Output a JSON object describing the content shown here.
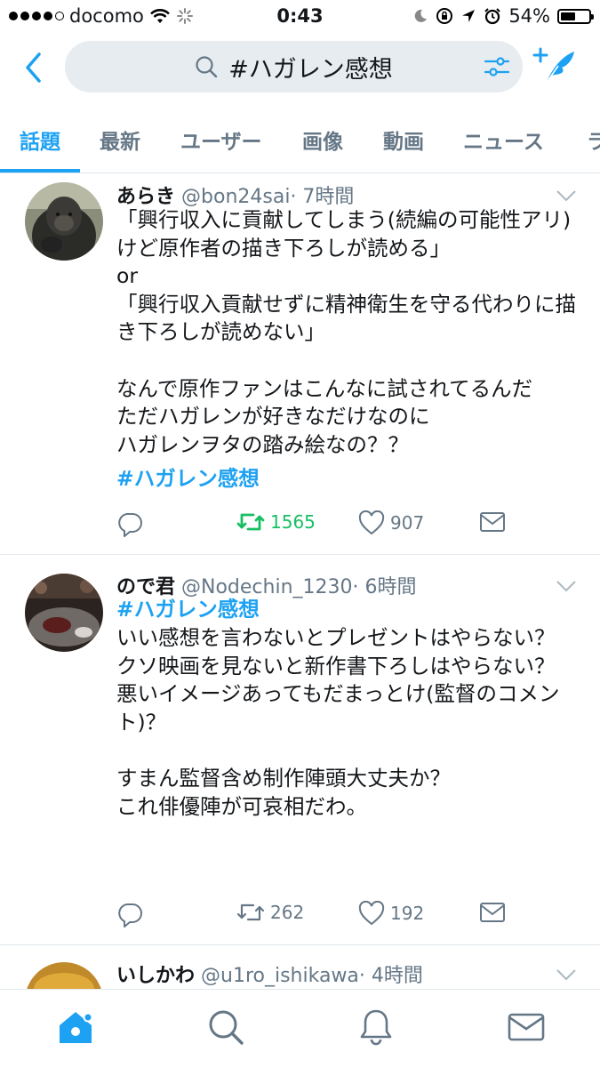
{
  "status_bar": {
    "carrier": "docomo",
    "time": "0:43",
    "battery": "54%",
    "battery_level": 0.54
  },
  "search": {
    "query": "#ハガレン感想"
  },
  "tabs": [
    {
      "label": "話題",
      "active": true
    },
    {
      "label": "最新",
      "active": false
    },
    {
      "label": "ユーザー",
      "active": false
    },
    {
      "label": "画像",
      "active": false
    },
    {
      "label": "動画",
      "active": false
    },
    {
      "label": "ニュース",
      "active": false
    },
    {
      "label": "ラ",
      "active": false
    }
  ],
  "tweets": [
    {
      "name": "あらき",
      "handle": "@bon24sai",
      "time": "· 7時間",
      "body": "「興行収入に貢献してしまう(続編の可能性アリ) けど原作者の描き下ろしが読める」\nor\n「興行収入貢献せずに精神衛生を守る代わりに描き下ろしが読めない」\n\nなんで原作ファンはこんなに試されてるんだ\nただハガレンが好きなだけなのに\nハガレンヲタの踏み絵なの？？",
      "hashtag": "#ハガレン感想",
      "retweets": "1565",
      "likes": "907"
    },
    {
      "name": "ので君",
      "handle": "@Nodechin_1230",
      "time": "· 6時間",
      "hashtag": "#ハガレン感想",
      "body": "いい感想を言わないとプレゼントはやらない？\nクソ映画を見ないと新作書下ろしはやらない？\n悪いイメージあってもだまっとけ(監督のコメント)？\n\nすまん監督含め制作陣頭大丈夫か？\nこれ俳優陣が可哀相だわ。",
      "retweets": "262",
      "likes": "192"
    },
    {
      "name": "いしかわ",
      "handle": "@u1ro_ishikawa",
      "time": "· 4時間"
    }
  ],
  "colors": {
    "accent": "#1da1f2",
    "retweet_active": "#17bf63",
    "muted": "#657786",
    "search_bg": "#e6ecf0"
  },
  "icons": [
    "back-chevron-icon",
    "search-icon",
    "filter-icon",
    "compose-icon",
    "chevron-down-icon",
    "reply-icon",
    "retweet-icon",
    "like-icon",
    "dm-icon",
    "home-icon",
    "explore-icon",
    "notifications-icon",
    "messages-icon"
  ]
}
